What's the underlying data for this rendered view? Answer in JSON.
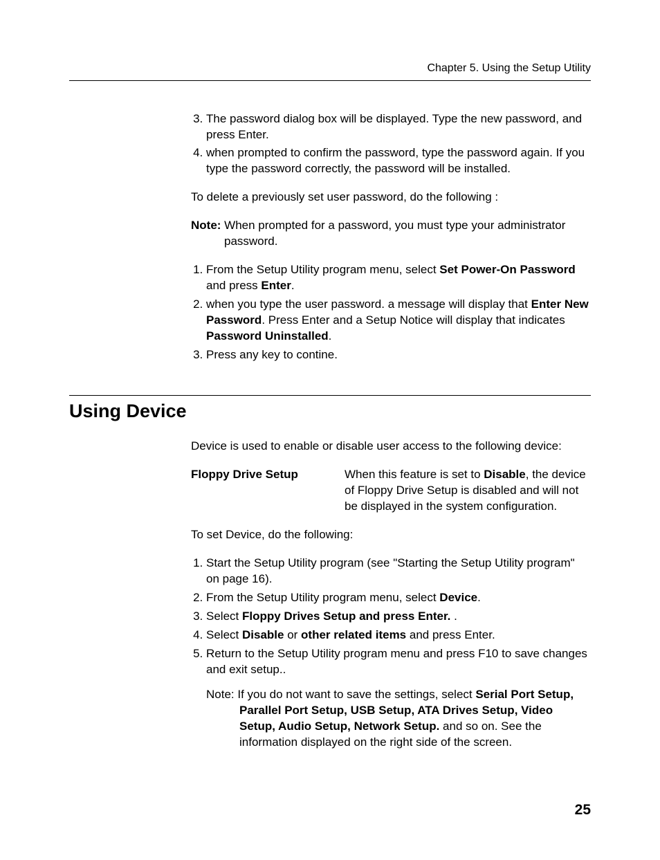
{
  "header": {
    "running_head": "Chapter 5. Using the Setup Utility"
  },
  "top_list": {
    "item3": "The password dialog box will be displayed. Type the new password, and press Enter.",
    "item4": "when prompted to confirm the password, type the password again. If you type the password correctly, the password will be installed."
  },
  "delete_intro": "To delete a previously set user password, do the following :",
  "note1": {
    "label": "Note:",
    "text": " When prompted for a password, you must type your  administrator password."
  },
  "delete_list": {
    "item1_a": "From the Setup Utility program menu, select  ",
    "item1_bold": "Set Power-On Password",
    "item1_b": " and press ",
    "item1_bold2": "Enter",
    "item1_c": ".",
    "item2_a": "when you type the user password. a message will display that ",
    "item2_bold1": "Enter New Password",
    "item2_b": ". Press Enter and a  Setup Notice will display that indicates  ",
    "item2_bold2": "Password Uninstalled",
    "item2_c": ".",
    "item3": "Press any key to contine."
  },
  "section": {
    "title": "Using Device",
    "intro": "Device is used to enable or disable user access to the following device:",
    "def_term": "Floppy Drive Setup",
    "def_desc_a": "When this feature is set to ",
    "def_desc_bold": "Disable",
    "def_desc_b": ", the device of Floppy Drive Setup is disabled and will not be displayed in the system configuration.",
    "set_intro": "To set Device, do the following:",
    "steps": {
      "s1": "Start the Setup Utility program (see \"Starting the Setup Utility program\" on page 16).",
      "s2_a": "From the Setup Utility program menu, select ",
      "s2_bold": "Device",
      "s2_b": ".",
      "s3_a": "Select ",
      "s3_bold": "Floppy Drives Setup and press Enter.",
      "s3_b": " .",
      "s4_a": "Select ",
      "s4_bold1": "Disable",
      "s4_mid": " or ",
      "s4_bold2": "other related items",
      "s4_b": " and press Enter.",
      "s5": "Return to the Setup Utility program menu and press F10  to save changes and exit setup.."
    },
    "note2": {
      "label": "Note:",
      "a": " If you do not want to save the settings, select ",
      "bold": "Serial Port Setup, Parallel Port Setup, USB Setup, ATA Drives Setup, Video Setup, Audio Setup, Network Setup.",
      "b": " and so on. See the information displayed on the right side of the screen."
    }
  },
  "page_number": "25"
}
